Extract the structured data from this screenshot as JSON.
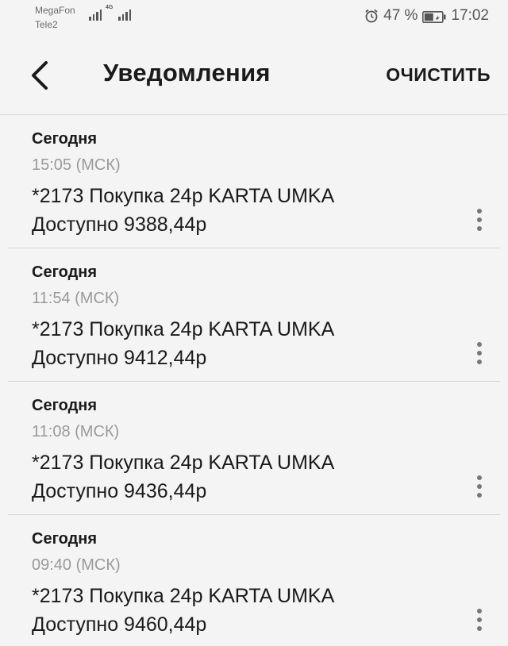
{
  "status_bar": {
    "carrier_1": "MegaFon",
    "carrier_2": "Tele2",
    "network_type": "4G",
    "battery_percent": "47 %",
    "time": "17:02"
  },
  "toolbar": {
    "title": "Уведомления",
    "clear_label": "ОЧИСТИТЬ"
  },
  "notifications": [
    {
      "date": "Сегодня",
      "time": "15:05 (МСК)",
      "line1": "*2173 Покупка 24р KARTA UMKA",
      "line2": "Доступно 9388,44р"
    },
    {
      "date": "Сегодня",
      "time": "11:54 (МСК)",
      "line1": "*2173 Покупка 24р KARTA UMKA",
      "line2": "Доступно 9412,44р"
    },
    {
      "date": "Сегодня",
      "time": "11:08 (МСК)",
      "line1": "*2173 Покупка 24р KARTA UMKA",
      "line2": "Доступно 9436,44р"
    },
    {
      "date": "Сегодня",
      "time": "09:40 (МСК)",
      "line1": "*2173 Покупка 24р KARTA UMKA",
      "line2": "Доступно 9460,44р"
    }
  ]
}
